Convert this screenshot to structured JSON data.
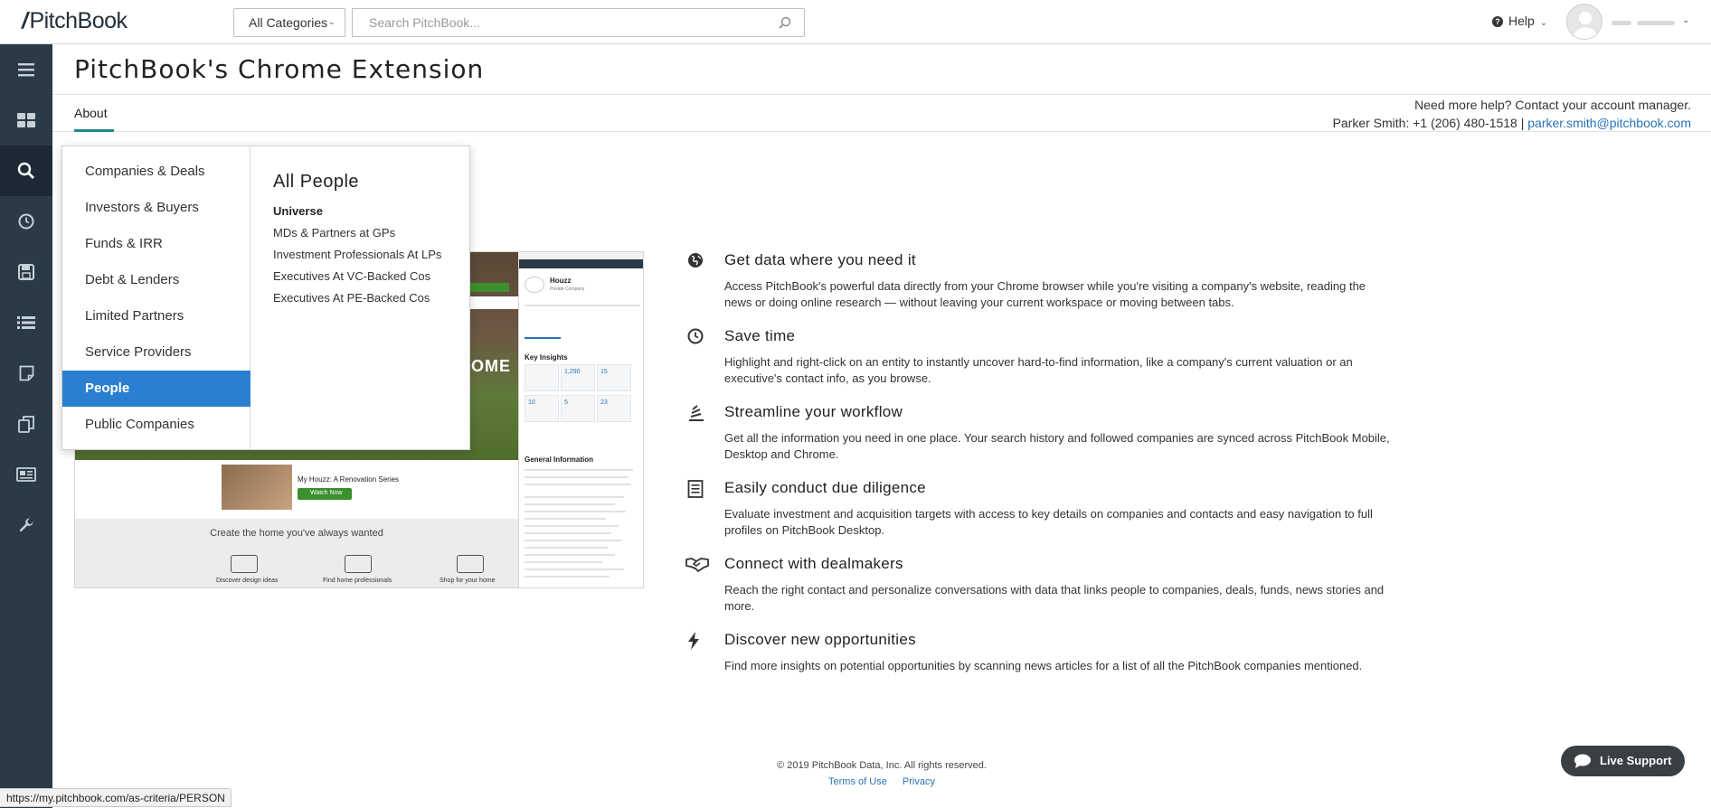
{
  "topbar": {
    "logo_text": "PitchBook",
    "category_select": "All Categories",
    "search_placeholder": "Search PitchBook...",
    "help_label": "Help"
  },
  "rail": {
    "icons": [
      "hamburger-menu-icon",
      "dashboard-icon",
      "search-icon",
      "history-clock-icon",
      "save-disk-icon",
      "list-icon",
      "notes-icon",
      "copy-docs-icon",
      "news-icon",
      "tools-wrench-icon"
    ],
    "active_index": 2
  },
  "page": {
    "title": "PitchBook's Chrome Extension",
    "tab_about": "About",
    "help_line": "Need more help? Contact your account manager.",
    "contact_name_phone": "Parker Smith: +1 (206) 480-1518 |",
    "contact_email": "parker.smith@pitchbook.com"
  },
  "menu": {
    "items": [
      {
        "label": "Companies & Deals"
      },
      {
        "label": "Investors & Buyers"
      },
      {
        "label": "Funds & IRR"
      },
      {
        "label": "Debt & Lenders"
      },
      {
        "label": "Limited Partners"
      },
      {
        "label": "Service Providers"
      },
      {
        "label": "People"
      },
      {
        "label": "Public Companies"
      }
    ],
    "selected": "People",
    "panel_title": "All People",
    "panel_subtitle": "Universe",
    "links": [
      {
        "label": "MDs & Partners at GPs"
      },
      {
        "label": "Investment Professionals At LPs"
      },
      {
        "label": "Executives At VC-Backed Cos"
      },
      {
        "label": "Executives At PE-Backed Cos"
      }
    ]
  },
  "preview": {
    "home_text": "OME",
    "series_title": "My Houzz: A Renovation Series",
    "watch_now": "Watch Now",
    "create_text": "Create the home you've always wanted",
    "icon_labels": [
      "Discover design ideas",
      "Find home professionals",
      "Shop for your home"
    ],
    "company": "Houzz",
    "company_type": "Private Company",
    "key_insights": "Key Insights",
    "stats": [
      "1,290",
      "15",
      "10",
      "5",
      "23"
    ],
    "general_information": "General Information"
  },
  "features": [
    {
      "icon": "globe-icon",
      "title": "Get data where you need it",
      "desc": "Access PitchBook's powerful data directly from your Chrome browser while you're visiting a company's website, reading the news or doing online research — without leaving your current workspace or moving between tabs."
    },
    {
      "icon": "clock-icon",
      "title": "Save time",
      "desc": "Highlight and right-click on an entity to instantly uncover hard-to-find information, like a company's current valuation or an executive's contact info, as you browse."
    },
    {
      "icon": "stack-icon",
      "title": "Streamline your workflow",
      "desc": "Get all the information you need in one place. Your search history and followed companies are synced across PitchBook Mobile, Desktop and Chrome."
    },
    {
      "icon": "checklist-icon",
      "title": "Easily conduct due diligence",
      "desc": "Evaluate investment and acquisition targets with access to key details on companies and contacts and easy navigation to full profiles on PitchBook Desktop."
    },
    {
      "icon": "handshake-icon",
      "title": "Connect with dealmakers",
      "desc": "Reach the right contact and personalize conversations with data that links people to companies, deals, funds, news stories and more."
    },
    {
      "icon": "lightning-icon",
      "title": "Discover new opportunities",
      "desc": "Find more insights on potential opportunities by scanning news articles for a list of all the PitchBook companies mentioned."
    }
  ],
  "footer": {
    "copyright": "© 2019 PitchBook Data, Inc. All rights reserved.",
    "terms": "Terms of Use",
    "privacy": "Privacy",
    "live_support": "Live Support"
  },
  "status_url": "https://my.pitchbook.com/as-criteria/PERSON",
  "colors": {
    "rail_bg": "#2b3a47",
    "accent_teal": "#1f8a8a",
    "menu_selected": "#2a7fd0",
    "link_blue": "#2a73b8"
  }
}
